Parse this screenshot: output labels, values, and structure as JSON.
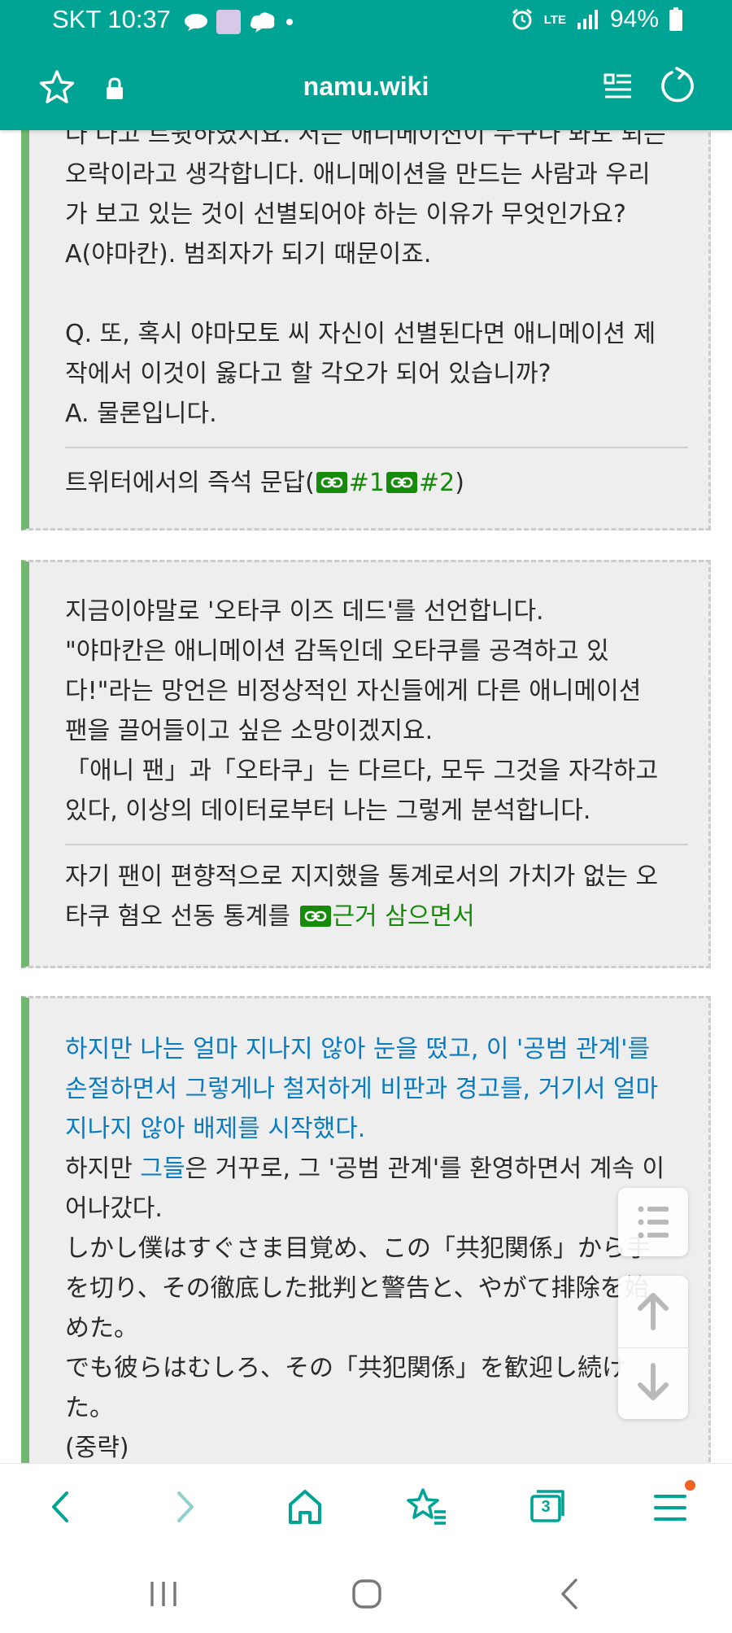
{
  "status_bar": {
    "carrier_time": "SKT 10:37",
    "battery": "94%",
    "network": "LTE",
    "notification_icons": [
      "chat-bubble-icon",
      "profile-image-icon",
      "cloud-chat-icon",
      "dot-icon"
    ]
  },
  "address_bar": {
    "url": "namu.wiki"
  },
  "quotes": [
    {
      "lines": [
        "다 다고 트윗하였지요. 저는 애니메이션이 누구나 봐도 되는",
        "오락이라고 생각합니다. 애니메이션을 만드는 사람과 우리",
        "가 보고 있는 것이 선별되어야 하는 이유가 무엇인가요?",
        "A(야마칸). 범죄자가 되기 때문이죠.",
        "",
        "Q. 또, 혹시 야마모토 씨 자신이 선별된다면 애니메이션 제",
        "작에서 이것이 옳다고 할 각오가 되어 있습니까?",
        "A. 물론입니다."
      ],
      "source_prefix": "트위터에서의 즉석 문답(",
      "source_link1": "#1",
      "source_link2": "#2",
      "source_suffix": ")"
    },
    {
      "lines": [
        "지금이야말로 '오타쿠 이즈 데드'를 선언합니다.",
        "\"야마칸은 애니메이션 감독인데 오타쿠를 공격하고 있",
        "다!\"라는 망언은 비정상적인 자신들에게 다른 애니메이션",
        "팬을 끌어들이고 싶은 소망이겠지요.",
        "「애니 팬」과「오타쿠」는 다르다, 모두 그것을 자각하고",
        "있다, 이상의 데이터로부터 나는 그렇게 분석합니다."
      ],
      "source_line1": "자기 팬이 편향적으로 지지했을 통계로서의 가치가 없는 오",
      "source_line2_prefix": "타쿠 혐오 선동 통계를 ",
      "source_line2_link": "근거 삼으면서"
    },
    {
      "blue_lines": [
        "하지만 나는 얼마 지나지 않아 눈을 떴고, 이 '공범 관계'를",
        "손절하면서 그렇게나 철저하게 비판과 경고를, 거기서 얼마",
        "지나지 않아 배제를 시작했다."
      ],
      "line4_prefix": "하지만 ",
      "line4_blue": "그들",
      "line4_suffix": "은 거꾸로, 그 '공범 관계'를 환영하면서 계속 이",
      "lines": [
        "어나갔다.",
        "しかし僕はすぐさま目覚め、この「共犯関係」から手",
        "を切り、その徹底した批判と警告と、やがて排除を始",
        "めた。",
        "でも彼らはむしろ、その「共犯関係」を歓迎し続け",
        "た。",
        "(중략)"
      ]
    }
  ],
  "floating_tools": [
    "toc-icon",
    "scroll-up-icon",
    "scroll-down-icon"
  ],
  "bottom_nav": {
    "tab_count": "3",
    "items": [
      "back-icon",
      "forward-icon",
      "home-icon",
      "bookmarks-icon",
      "tabs-icon",
      "menu-icon"
    ]
  },
  "colors": {
    "accent": "#00a495",
    "quote_border": "#71b76f",
    "link_green": "#168b0a",
    "link_blue": "#0a7bbf"
  }
}
